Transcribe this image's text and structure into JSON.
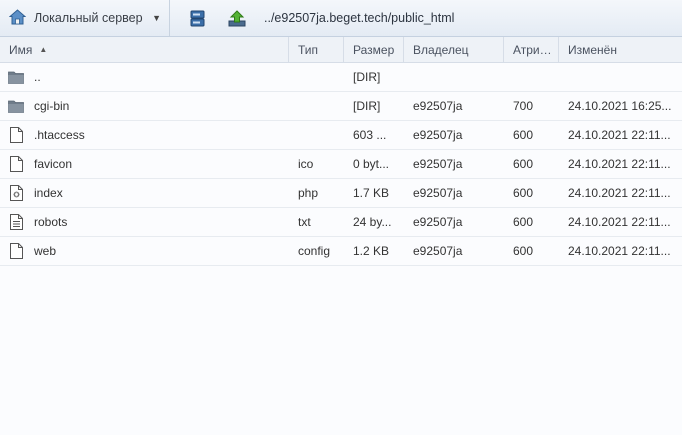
{
  "toolbar": {
    "server_label": "Локальный сервер",
    "path": "../e92507ja.beget.tech/public_html"
  },
  "columns": {
    "name": "Имя",
    "type": "Тип",
    "size": "Размер",
    "owner": "Владелец",
    "attr": "Атри…",
    "modified": "Изменён"
  },
  "files": [
    {
      "icon": "folder-icon",
      "name": "..",
      "type": "",
      "size": "[DIR]",
      "owner": "",
      "attr": "",
      "modified": ""
    },
    {
      "icon": "folder-icon",
      "name": "cgi-bin",
      "type": "",
      "size": "[DIR]",
      "owner": "e92507ja",
      "attr": "700",
      "modified": "24.10.2021 16:25..."
    },
    {
      "icon": "file-icon",
      "name": ".htaccess",
      "type": "",
      "size": "603 ...",
      "owner": "e92507ja",
      "attr": "600",
      "modified": "24.10.2021 22:11..."
    },
    {
      "icon": "file-icon",
      "name": "favicon",
      "type": "ico",
      "size": "0 byt...",
      "owner": "e92507ja",
      "attr": "600",
      "modified": "24.10.2021 22:11..."
    },
    {
      "icon": "code-file-icon",
      "name": "index",
      "type": "php",
      "size": "1.7 KB",
      "owner": "e92507ja",
      "attr": "600",
      "modified": "24.10.2021 22:11..."
    },
    {
      "icon": "text-file-icon",
      "name": "robots",
      "type": "txt",
      "size": "24 by...",
      "owner": "e92507ja",
      "attr": "600",
      "modified": "24.10.2021 22:11..."
    },
    {
      "icon": "file-icon",
      "name": "web",
      "type": "config",
      "size": "1.2 KB",
      "owner": "e92507ja",
      "attr": "600",
      "modified": "24.10.2021 22:11..."
    }
  ]
}
